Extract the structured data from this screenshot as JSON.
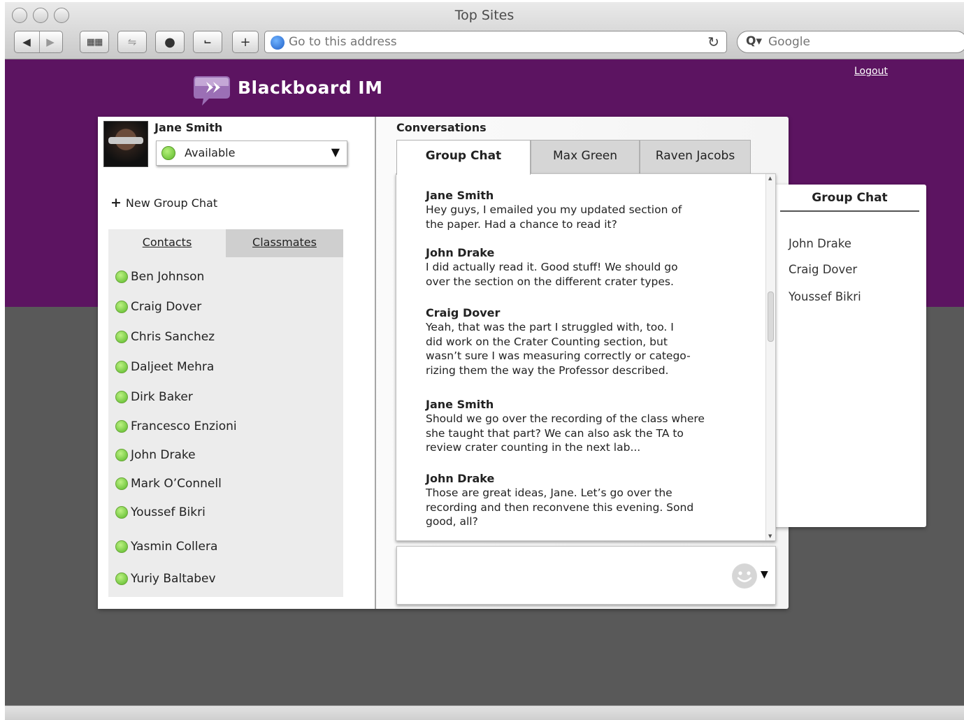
{
  "browser": {
    "window_title": "Top Sites",
    "address_placeholder": "Go to this address",
    "search_placeholder": "Google"
  },
  "app": {
    "title": "Blackboard IM",
    "logout_label": "Logout"
  },
  "user": {
    "name": "Jane Smith",
    "status": "Available"
  },
  "sidebar": {
    "new_group_chat_label": "New Group Chat",
    "tabs": [
      {
        "label": "Contacts",
        "active": true
      },
      {
        "label": "Classmates",
        "active": false
      }
    ],
    "contacts": [
      {
        "name": "Ben Johnson"
      },
      {
        "name": "Craig Dover"
      },
      {
        "name": "Chris Sanchez"
      },
      {
        "name": "Daljeet Mehra"
      },
      {
        "name": "Dirk Baker"
      },
      {
        "name": "Francesco Enzioni"
      },
      {
        "name": "John Drake"
      },
      {
        "name": "Mark O’Connell"
      },
      {
        "name": "Youssef Bikri"
      },
      {
        "name": "Yasmin Collera"
      },
      {
        "name": "Yuriy Baltabev"
      }
    ]
  },
  "conversations": {
    "label": "Conversations",
    "tabs": [
      {
        "label": "Group Chat",
        "active": true
      },
      {
        "label": "Max Green",
        "active": false
      },
      {
        "label": "Raven Jacobs",
        "active": false
      }
    ],
    "messages": [
      {
        "author": "Jane Smith",
        "lines": [
          "Hey guys, I emailed you my updated section of",
          "the paper. Had a chance to read it?"
        ]
      },
      {
        "author": "John Drake",
        "lines": [
          "I did actually read it. Good stuff! We should go",
          "over the section on the different crater types."
        ]
      },
      {
        "author": "Craig Dover",
        "lines": [
          "Yeah, that was the part I struggled with, too. I",
          "did work on the Crater Counting section, but",
          "wasn’t sure I was measuring correctly or catego-",
          "rizing them the way the Professor described."
        ]
      },
      {
        "author": "Jane Smith",
        "lines": [
          "Should we go over the recording of the class where",
          "she taught that part? We can also ask the TA to",
          "review crater counting in the next lab..."
        ]
      },
      {
        "author": "John Drake",
        "lines": [
          "Those are great ideas, Jane. Let’s go over the",
          "recording and then reconvene this evening. Sond",
          "good, all?"
        ]
      }
    ],
    "compose_value": ""
  },
  "group_panel": {
    "title": "Group Chat",
    "members": [
      "John Drake",
      "Craig Dover",
      "Youssef Bikri"
    ]
  },
  "colors": {
    "brand_purple": "#5c1461",
    "page_gray": "#595959",
    "status_green": "#5cb82a"
  },
  "icons": {
    "back": "back-arrow-icon",
    "forward": "forward-arrow-icon",
    "top_sites": "grid-icon",
    "reload": "reload-icon",
    "search": "search-icon",
    "emoji": "smiley-icon"
  }
}
